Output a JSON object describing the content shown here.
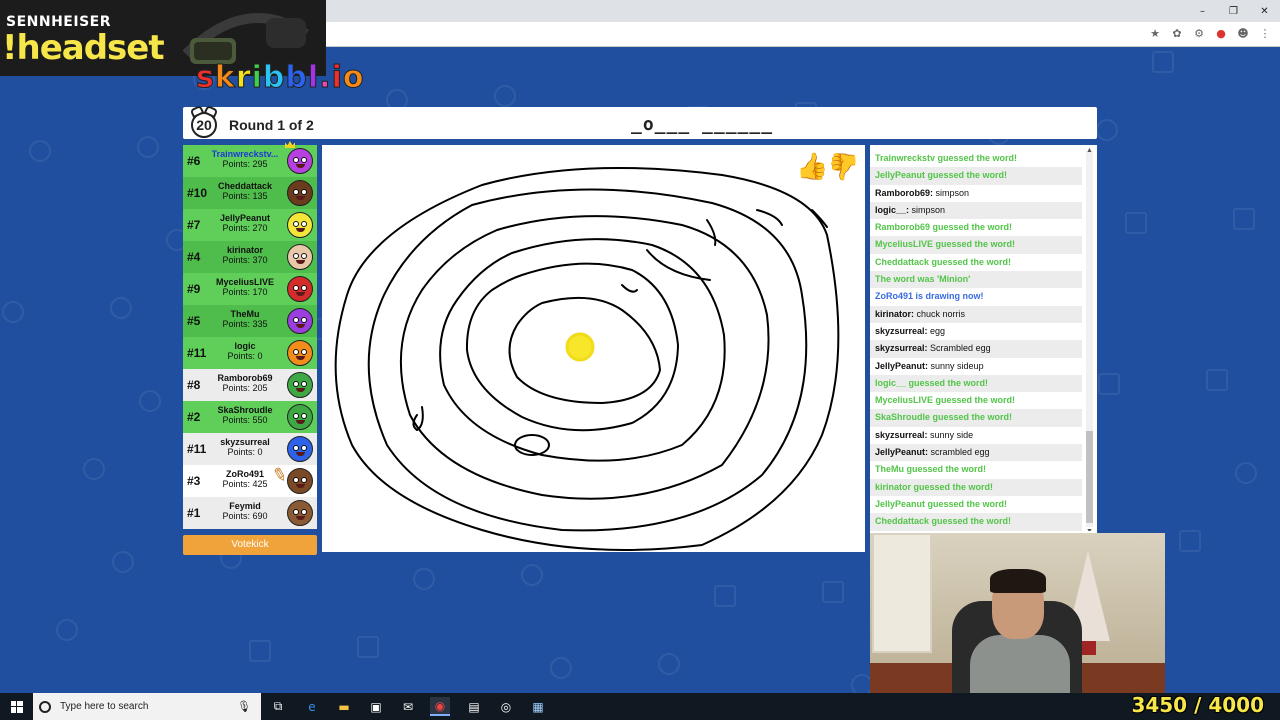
{
  "browser": {
    "window_controls": [
      "–",
      "❐",
      "✕"
    ],
    "extension_icons": [
      "★",
      "✿",
      "⚙",
      "●",
      "☻",
      "⋮"
    ]
  },
  "sponsor": {
    "brand": "SENNHEISER",
    "command": "!headset"
  },
  "logo": {
    "letters": [
      "s",
      "k",
      "r",
      "i",
      "b",
      "b",
      "l",
      ".",
      "i",
      "o"
    ]
  },
  "game": {
    "timer": "20",
    "round": "Round 1 of 2",
    "word_hint": "_o___ ______"
  },
  "players": [
    {
      "rank": "#6",
      "name": "Trainwreckstv...",
      "points": "Points: 295",
      "color": "#b640e0",
      "self": true,
      "guessed": true,
      "crown": true
    },
    {
      "rank": "#10",
      "name": "Cheddattack",
      "points": "Points: 135",
      "color": "#6b3b1e",
      "guessed": true
    },
    {
      "rank": "#7",
      "name": "JellyPeanut",
      "points": "Points: 270",
      "color": "#f3e63b",
      "guessed": true
    },
    {
      "rank": "#4",
      "name": "kirinator",
      "points": "Points: 370",
      "color": "#e7c8a8",
      "guessed": true
    },
    {
      "rank": "#9",
      "name": "MyceliusLIVE",
      "points": "Points: 170",
      "color": "#d42b2b",
      "guessed": true
    },
    {
      "rank": "#5",
      "name": "TheMu",
      "points": "Points: 335",
      "color": "#9b3ee0",
      "guessed": true
    },
    {
      "rank": "#11",
      "name": "logic",
      "points": "Points: 0",
      "color": "#f28c1a",
      "guessed": true
    },
    {
      "rank": "#8",
      "name": "Ramborob69",
      "points": "Points: 205",
      "color": "#3ea844",
      "guessed": false
    },
    {
      "rank": "#2",
      "name": "SkaShroudle",
      "points": "Points: 550",
      "color": "#3ea844",
      "guessed": true
    },
    {
      "rank": "#11",
      "name": "skyzsurreal",
      "points": "Points: 0",
      "color": "#2c63e8",
      "guessed": false
    },
    {
      "rank": "#3",
      "name": "ZoRo491",
      "points": "Points: 425",
      "color": "#7a4a26",
      "guessed": false,
      "drawing": true
    },
    {
      "rank": "#1",
      "name": "Feymid",
      "points": "Points: 690",
      "color": "#8a5a34",
      "guessed": false
    }
  ],
  "votekick_label": "Votekick",
  "chat": [
    {
      "type": "good",
      "text": "Trainwreckstv guessed the word!"
    },
    {
      "type": "good",
      "text": "JellyPeanut guessed the word!"
    },
    {
      "type": "msg",
      "user": "Ramborob69:",
      "text": " simpson"
    },
    {
      "type": "msg",
      "user": "logic__:",
      "text": " simpson"
    },
    {
      "type": "good",
      "text": "Ramborob69 guessed the word!"
    },
    {
      "type": "good",
      "text": "MyceliusLIVE guessed the word!"
    },
    {
      "type": "good",
      "text": "Cheddattack guessed the word!"
    },
    {
      "type": "good",
      "text": "The word was 'Minion'"
    },
    {
      "type": "blue",
      "text": "ZoRo491 is drawing now!"
    },
    {
      "type": "msg",
      "user": "kirinator:",
      "text": " chuck norris"
    },
    {
      "type": "msg",
      "user": "skyzsurreal:",
      "text": " egg"
    },
    {
      "type": "msg",
      "user": "skyzsurreal:",
      "text": " Scrambled egg"
    },
    {
      "type": "msg",
      "user": "JellyPeanut:",
      "text": " sunny sideup"
    },
    {
      "type": "good",
      "text": "logic__ guessed the word!"
    },
    {
      "type": "good",
      "text": "MyceliusLIVE guessed the word!"
    },
    {
      "type": "good",
      "text": "SkaShroudle guessed the word!"
    },
    {
      "type": "msg",
      "user": "skyzsurreal:",
      "text": " sunny side"
    },
    {
      "type": "msg",
      "user": "JellyPeanut:",
      "text": " scrambled egg"
    },
    {
      "type": "good",
      "text": "TheMu guessed the word!"
    },
    {
      "type": "good",
      "text": "kirinator guessed the word!"
    },
    {
      "type": "good",
      "text": "JellyPeanut guessed the word!"
    },
    {
      "type": "good",
      "text": "Cheddattack guessed the word!"
    }
  ],
  "stream_overlay": {
    "score": "3450 / 4000"
  },
  "taskbar": {
    "search_placeholder": "Type here to search",
    "icons": [
      "task-view-icon",
      "edge-icon",
      "file-explorer-icon",
      "store-icon",
      "mail-icon",
      "chrome-icon",
      "app-icon",
      "obs-icon",
      "notepad-icon"
    ]
  }
}
